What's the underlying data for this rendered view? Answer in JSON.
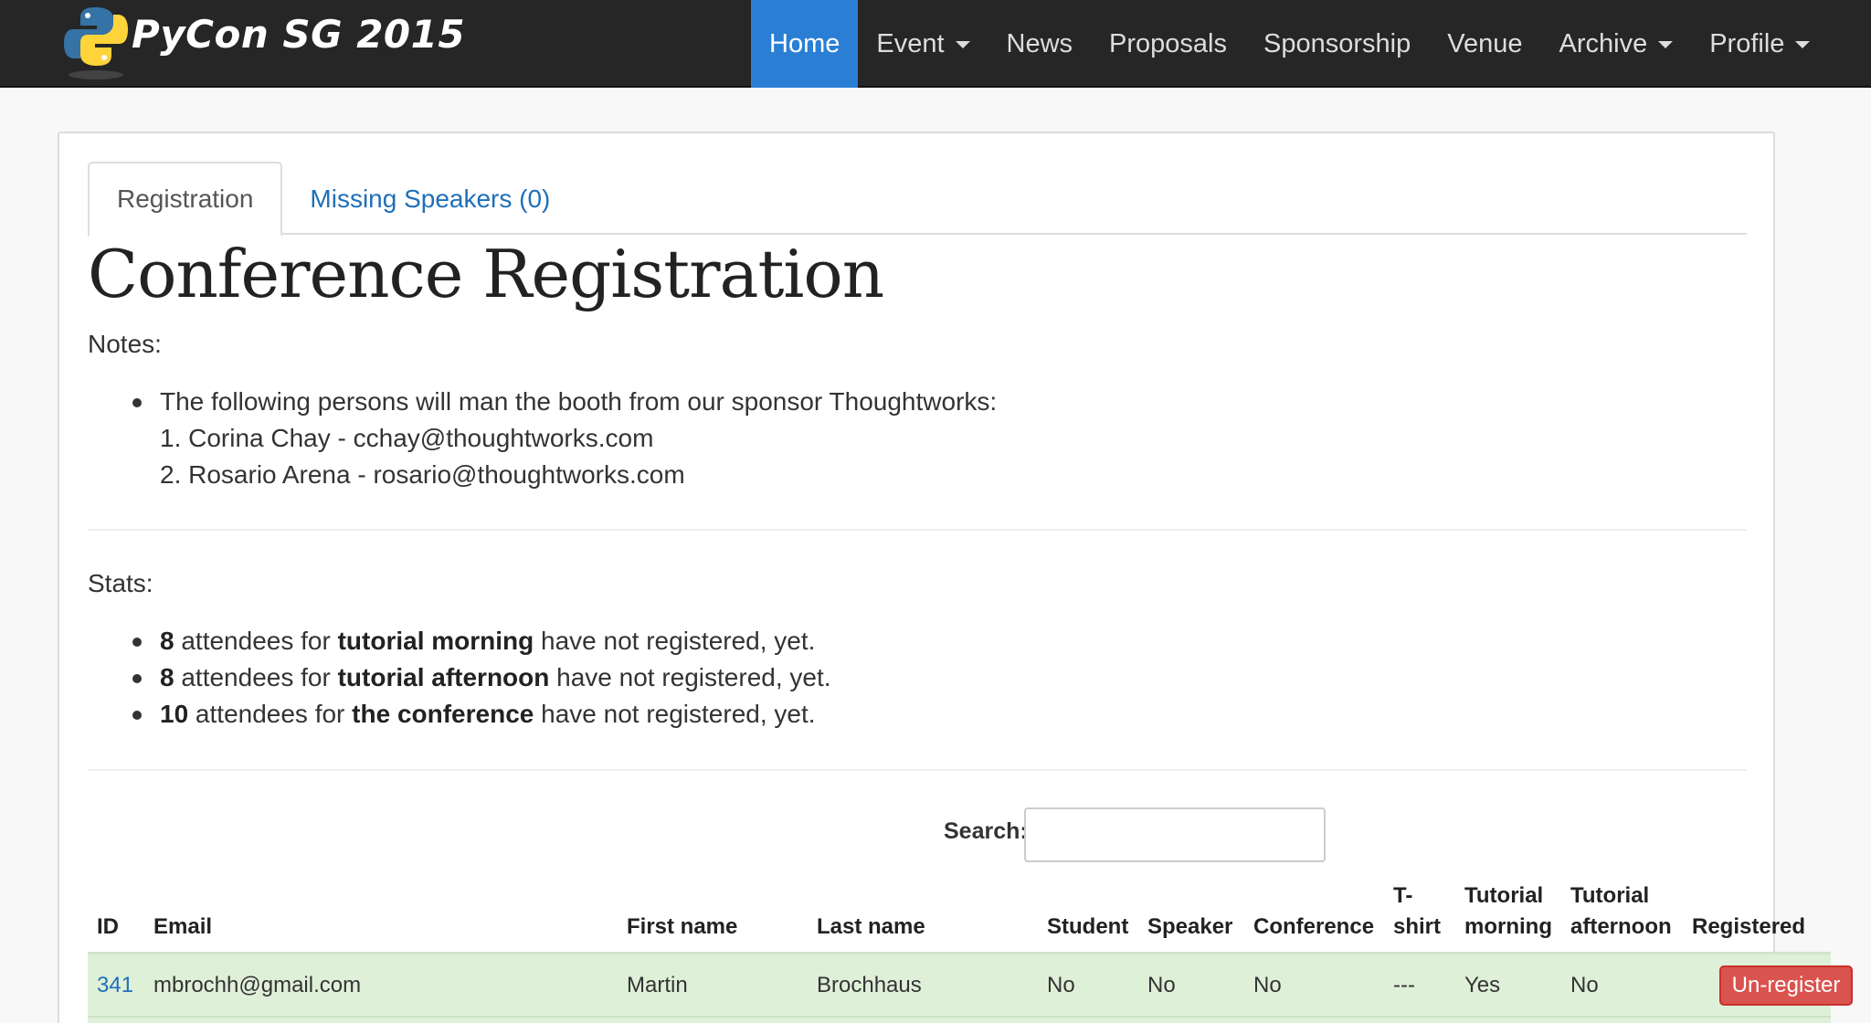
{
  "navbar": {
    "brand": "PyCon SG 2015",
    "items": [
      {
        "label": "Home",
        "active": true,
        "dropdown": false
      },
      {
        "label": "Event",
        "active": false,
        "dropdown": true
      },
      {
        "label": "News",
        "active": false,
        "dropdown": false
      },
      {
        "label": "Proposals",
        "active": false,
        "dropdown": false
      },
      {
        "label": "Sponsorship",
        "active": false,
        "dropdown": false
      },
      {
        "label": "Venue",
        "active": false,
        "dropdown": false
      },
      {
        "label": "Archive",
        "active": false,
        "dropdown": true
      },
      {
        "label": "Profile",
        "active": false,
        "dropdown": true
      }
    ]
  },
  "tabs": [
    {
      "label": "Registration",
      "active": true
    },
    {
      "label": "Missing Speakers (0)",
      "active": false
    }
  ],
  "page_title": "Conference Registration",
  "notes": {
    "label": "Notes:",
    "bullet": "The following persons will man the booth from our sponsor Thoughtworks:",
    "persons": [
      "1. Corina Chay - cchay@thoughtworks.com",
      "2. Rosario Arena - rosario@thoughtworks.com"
    ]
  },
  "stats": {
    "label": "Stats:",
    "items": [
      {
        "count": "8",
        "pre": " attendees for ",
        "target": "tutorial morning",
        "post": " have not registered, yet."
      },
      {
        "count": "8",
        "pre": " attendees for ",
        "target": "tutorial afternoon",
        "post": " have not registered, yet."
      },
      {
        "count": "10",
        "pre": " attendees for ",
        "target": "the conference",
        "post": " have not registered, yet."
      }
    ]
  },
  "search": {
    "label": "Search:",
    "value": ""
  },
  "table": {
    "headers": {
      "id": "ID",
      "email": "Email",
      "first_name": "First name",
      "last_name": "Last name",
      "student": "Student",
      "speaker": "Speaker",
      "conference": "Conference",
      "tshirt_1": "T-",
      "tshirt_2": "shirt",
      "tut_morning_1": "Tutorial",
      "tut_morning_2": "morning",
      "tut_afternoon_1": "Tutorial",
      "tut_afternoon_2": "afternoon",
      "registered": "Registered"
    },
    "rows": [
      {
        "id": "341",
        "email": "mbrochh@gmail.com",
        "first_name": "Martin",
        "last_name": "Brochhaus",
        "student": "No",
        "speaker": "No",
        "conference": "No",
        "tshirt": "---",
        "tut_morning": "Yes",
        "tut_afternoon": "No",
        "action": "Un-register"
      }
    ]
  },
  "colors": {
    "nav_bg": "#262626",
    "nav_active": "#2a7fd4",
    "link": "#1f6fb8",
    "row_success": "#dff0d8",
    "danger": "#d9534f"
  }
}
